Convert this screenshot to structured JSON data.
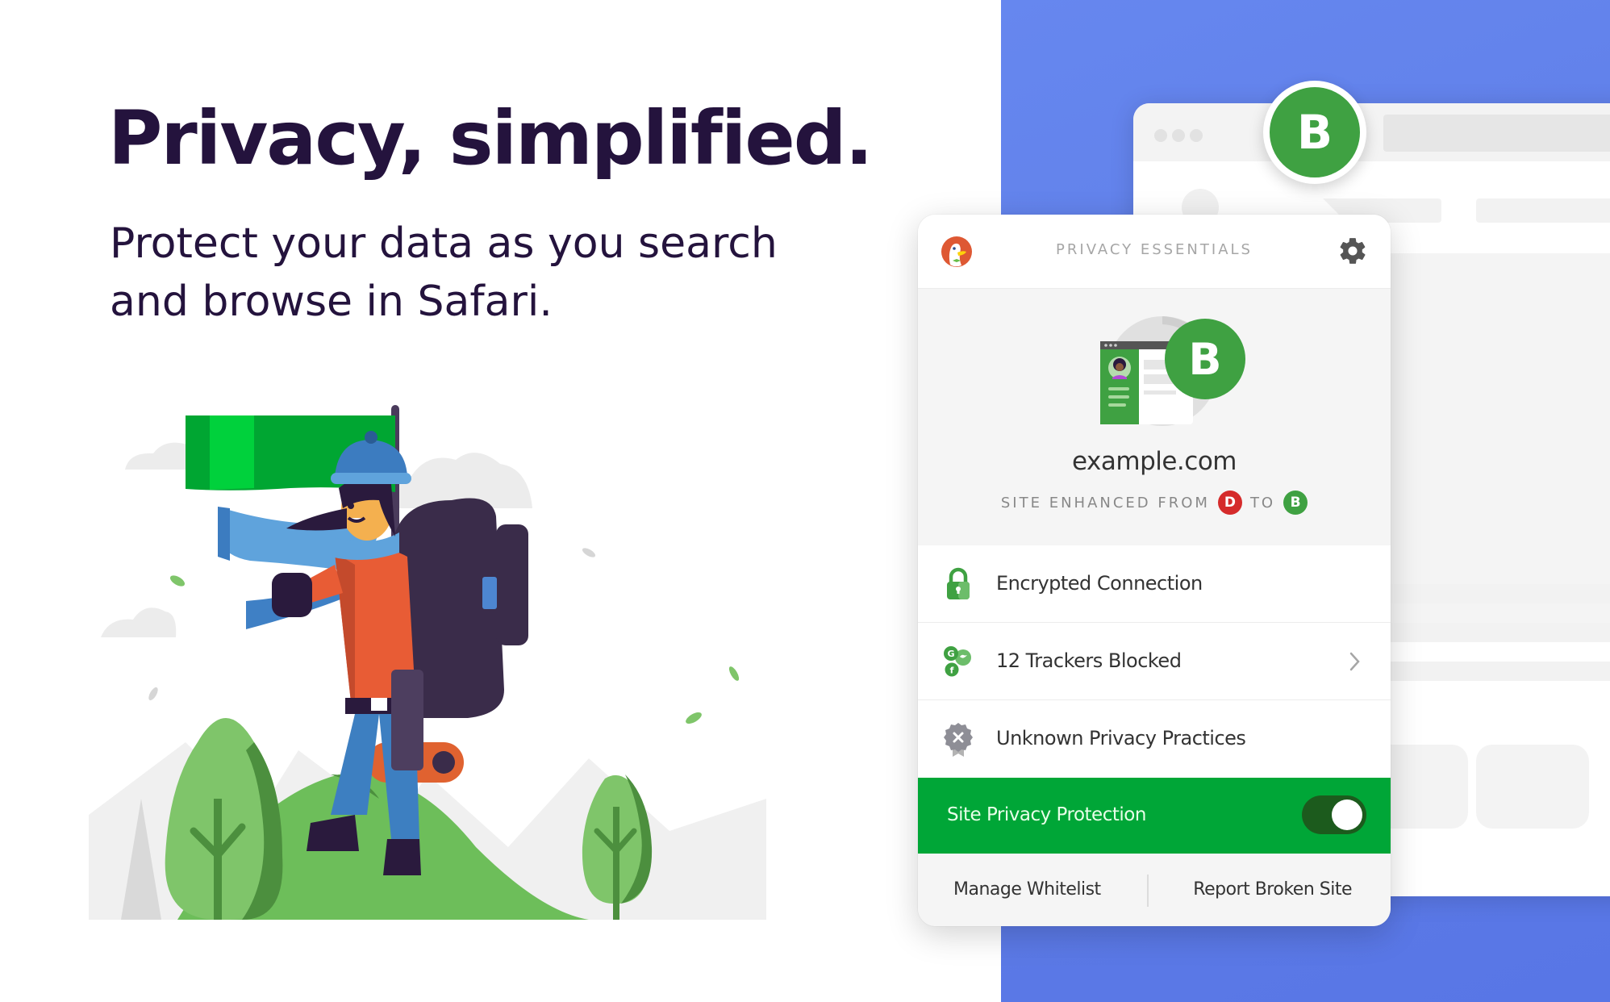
{
  "marketing": {
    "headline": "Privacy, simplified.",
    "subhead_line1": "Protect your data as you search",
    "subhead_line2": "and browse in Safari."
  },
  "browser_mock": {
    "grade_badge": "B"
  },
  "popup": {
    "header": {
      "title": "PRIVACY ESSENTIALS",
      "logo_icon": "duckduckgo-logo",
      "settings_icon": "gear-icon"
    },
    "hero": {
      "site": "example.com",
      "grade": "B",
      "enhanced_prefix": "SITE ENHANCED FROM",
      "from_grade": "D",
      "enhanced_to": "TO",
      "to_grade": "B"
    },
    "rows": [
      {
        "label": "Encrypted Connection",
        "icon": "lock-icon",
        "has_chevron": false
      },
      {
        "label": "12 Trackers Blocked",
        "icon": "trackers-icon",
        "has_chevron": true
      },
      {
        "label": "Unknown Privacy Practices",
        "icon": "privacy-badge-icon",
        "has_chevron": false
      }
    ],
    "protection": {
      "label": "Site Privacy Protection",
      "enabled": true
    },
    "footer": {
      "manage_whitelist": "Manage Whitelist",
      "report_broken_site": "Report Broken Site"
    }
  },
  "colors": {
    "brand_green": "#00a637",
    "grade_green": "#3fa142",
    "grade_red": "#d52b2b",
    "panel_blue": "#5f7fea",
    "headline_purple": "#24133d"
  }
}
